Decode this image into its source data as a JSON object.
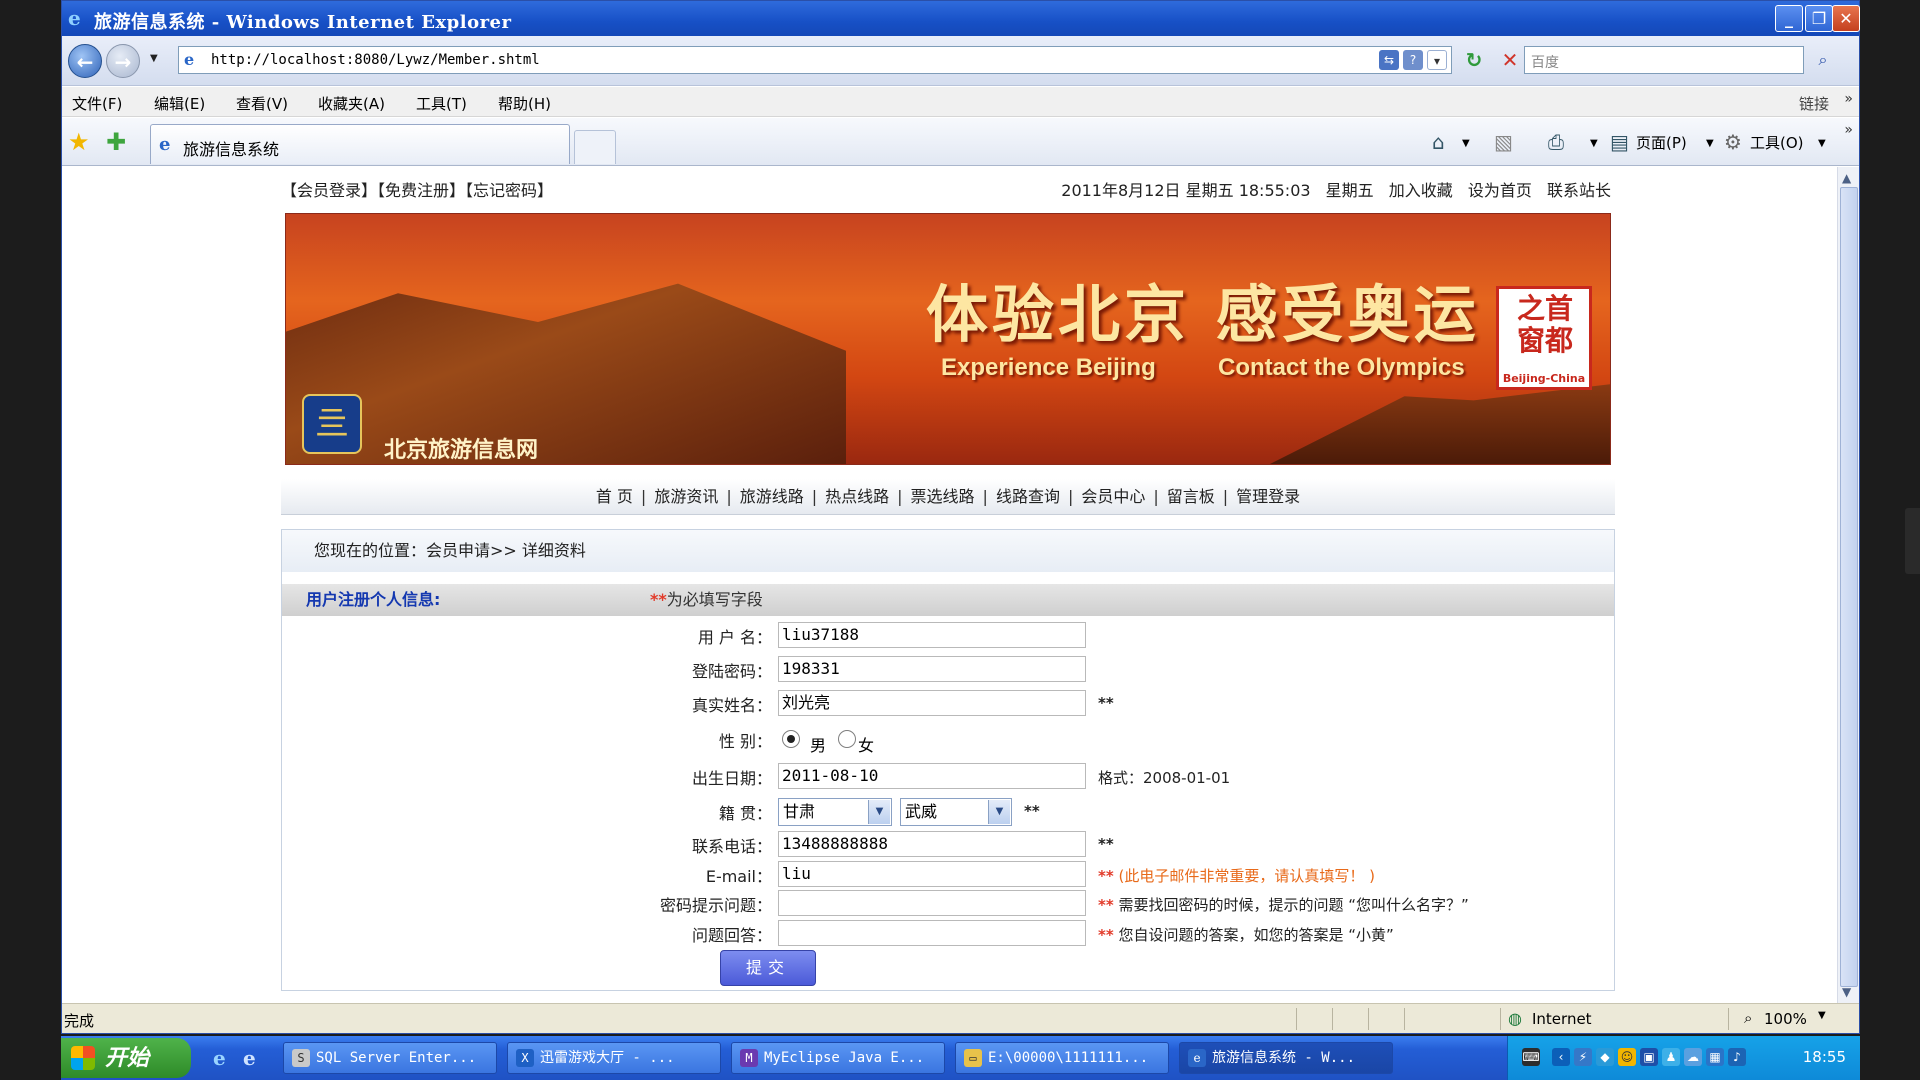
{
  "window": {
    "title": "旅游信息系统 - Windows Internet Explorer",
    "buttons": {
      "minimize": "_",
      "maximize": "❐",
      "close": "✕"
    }
  },
  "addressbar": {
    "url": "http://localhost:8080/Lywz/Member.shtml",
    "search_placeholder": "百度",
    "back_icon": "←",
    "forward_icon": "→"
  },
  "menubar": {
    "items": [
      "文件(F)",
      "编辑(E)",
      "查看(V)",
      "收藏夹(A)",
      "工具(T)",
      "帮助(H)"
    ],
    "links_label": "链接"
  },
  "tabbar": {
    "tab_label": "旅游信息系统",
    "page_menu": "页面(P)",
    "tools_menu": "工具(O)"
  },
  "page": {
    "top_left_links": "【会员登录】【免费注册】【忘记密码】",
    "datetime": "2011年8月12日  星期五  18:55:03",
    "weekday": "星期五",
    "top_right_links": [
      "加入收藏",
      "设为首页",
      "联系站长"
    ],
    "banner": {
      "headline": "体验北京 感受奥运",
      "en_left": "Experience Beijing",
      "en_right": "Contact the Olympics",
      "seal_chars": "之首\n窗都",
      "seal_en": "Beijing-China",
      "site_name": "北京旅游信息网"
    },
    "nav": [
      "首 页",
      "旅游资讯",
      "旅游线路",
      "热点线路",
      "票选线路",
      "线路查询",
      "会员中心",
      "留言板",
      "管理登录"
    ],
    "breadcrumb": "您现在的位置：会员申请>> 详细资料",
    "section_title": "用户注册个人信息:",
    "required_mark": "**",
    "required_note": "为必填写字段",
    "form": {
      "username_label": "用 户 名：",
      "username_value": "liu37188",
      "password_label": "登陆密码：",
      "password_value": "198331",
      "realname_label": "真实姓名：",
      "realname_value": "刘光亮",
      "gender_label": "性    别：",
      "gender_male": "男",
      "gender_female": "女",
      "birth_label": "出生日期：",
      "birth_value": "2011-08-10",
      "birth_format": "格式：2008-01-01",
      "origin_label": "籍    贯：",
      "province": "甘肃",
      "city": "武威",
      "phone_label": "联系电话：",
      "phone_value": "13488888888",
      "email_label": "E-mail：",
      "email_value": "liu",
      "email_note": "(此电子邮件非常重要，请认真填写！ )",
      "question_label": "密码提示问题：",
      "question_value": "",
      "question_note": "需要找回密码的时候，提示的问题 “您叫什么名字？”",
      "answer_label": "问题回答：",
      "answer_value": "",
      "answer_note": "您自设问题的答案，如您的答案是 “小黄”",
      "submit": "提交"
    }
  },
  "statusbar": {
    "status": "完成",
    "zone": "Internet",
    "zoom": "100%"
  },
  "taskbar": {
    "start": "开始",
    "tasks": [
      "SQL Server Enter...",
      "迅雷游戏大厅 - ...",
      "MyEclipse Java E...",
      "E:\\00000\\1111111...",
      "旅游信息系统 - W..."
    ],
    "clock": "18:55"
  },
  "colors": {
    "title_blue": "#1750c6",
    "required_red": "#e23b2a",
    "section_blue": "#1438b0",
    "note_orange": "#e86a1a"
  }
}
